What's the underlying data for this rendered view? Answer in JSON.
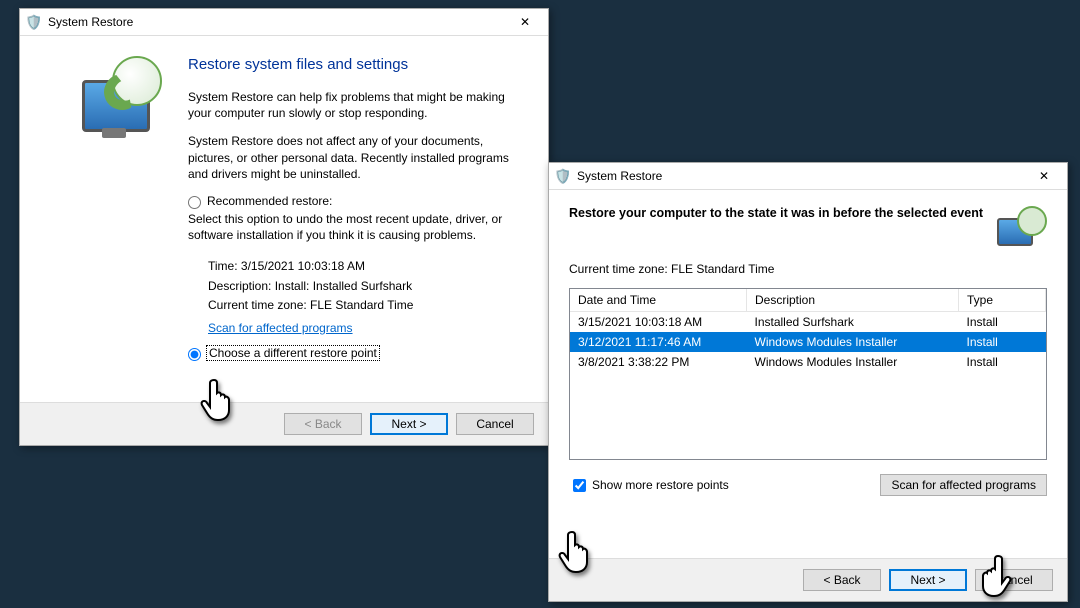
{
  "window1": {
    "title": "System Restore",
    "heading": "Restore system files and settings",
    "intro1": "System Restore can help fix problems that might be making your computer run slowly or stop responding.",
    "intro2": "System Restore does not affect any of your documents, pictures, or other personal data. Recently installed programs and drivers might be uninstalled.",
    "recommended_label": "Recommended restore:",
    "recommended_desc": "Select this option to undo the most recent update, driver, or software installation if you think it is causing problems.",
    "time_label": "Time: 3/15/2021 10:03:18 AM",
    "desc_label": "Description: Install: Installed Surfshark",
    "tz_label": "Current time zone: FLE Standard Time",
    "scan_link": "Scan for affected programs",
    "choose_label": "Choose a different restore point",
    "back": "< Back",
    "next": "Next >",
    "cancel": "Cancel"
  },
  "window2": {
    "title": "System Restore",
    "heading": "Restore your computer to the state it was in before the selected event",
    "tz": "Current time zone: FLE Standard Time",
    "cols": {
      "date": "Date and Time",
      "desc": "Description",
      "type": "Type"
    },
    "rows": [
      {
        "date": "3/15/2021 10:03:18 AM",
        "desc": "Installed Surfshark",
        "type": "Install",
        "selected": false
      },
      {
        "date": "3/12/2021 11:17:46 AM",
        "desc": "Windows Modules Installer",
        "type": "Install",
        "selected": true
      },
      {
        "date": "3/8/2021 3:38:22 PM",
        "desc": "Windows Modules Installer",
        "type": "Install",
        "selected": false
      }
    ],
    "show_more": "Show more restore points",
    "scan_btn": "Scan for affected programs",
    "back": "< Back",
    "next": "Next >",
    "cancel": "Cancel"
  }
}
